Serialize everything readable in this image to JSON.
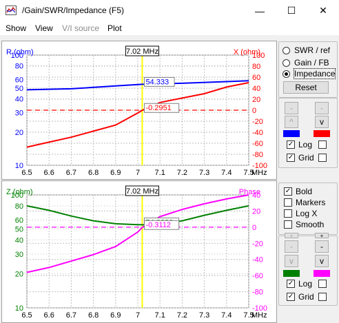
{
  "window": {
    "title": "/Gain/SWR/Impedance (F5)",
    "minimize_glyph": "—",
    "maximize_glyph": "☐",
    "close_glyph": "✕"
  },
  "menu": [
    {
      "label": "Show",
      "enabled": true
    },
    {
      "label": "View",
      "enabled": true
    },
    {
      "label": "V/I source",
      "enabled": false
    },
    {
      "label": "Plot",
      "enabled": true
    }
  ],
  "colors": {
    "blue": "#0000ff",
    "red": "#ff0000",
    "green": "#008000",
    "magenta": "#ff00ff",
    "marker": "#ffff00",
    "grid": "#bdbdbd"
  },
  "chart_data": [
    {
      "type": "line",
      "marker_label": "7.02 MHz",
      "marker_x": 7.02,
      "xlabel": "MHz",
      "xlim": [
        6.5,
        7.5
      ],
      "x_ticks": [
        6.5,
        6.6,
        6.7,
        6.8,
        6.9,
        7,
        7.1,
        7.2,
        7.3,
        7.4,
        7.5
      ],
      "left_axis": {
        "label": "R (ohm)",
        "scale": "log",
        "range": [
          10,
          100
        ],
        "ticks": [
          10,
          20,
          30,
          40,
          50,
          60,
          80,
          100
        ],
        "color": "blue"
      },
      "right_axis": {
        "label": "X (ohm)",
        "scale": "linear",
        "range": [
          -100,
          100
        ],
        "ticks": [
          -100,
          -80,
          -60,
          -40,
          -20,
          0,
          20,
          40,
          60,
          80,
          100
        ],
        "color": "red"
      },
      "series": [
        {
          "axis": "left",
          "color": "blue",
          "x": [
            6.5,
            6.7,
            6.9,
            7.02,
            7.2,
            7.4,
            7.5
          ],
          "y": [
            48.4,
            49.5,
            52.5,
            54.333,
            55.5,
            57.5,
            58.5
          ]
        },
        {
          "axis": "right",
          "color": "red",
          "x": [
            6.5,
            6.6,
            6.7,
            6.8,
            6.9,
            7,
            7.02,
            7.1,
            7.2,
            7.3,
            7.4,
            7.5
          ],
          "y": [
            -67,
            -58,
            -49,
            -38,
            -27,
            -5,
            -0.2951,
            14,
            22,
            30,
            42,
            50
          ]
        }
      ],
      "reference_line": {
        "axis": "right",
        "y": 0,
        "color": "red",
        "style": "dashed"
      },
      "readouts": [
        {
          "text": "54.333",
          "x": 7.02,
          "axis": "left",
          "y": 54.333
        },
        {
          "text": "-0.2951",
          "x": 7.02,
          "axis": "right",
          "y": -0.2951
        }
      ]
    },
    {
      "type": "line",
      "marker_label": "7.02 MHz",
      "marker_x": 7.02,
      "xlabel": "MHz",
      "xlim": [
        6.5,
        7.5
      ],
      "x_ticks": [
        6.5,
        6.6,
        6.7,
        6.8,
        6.9,
        7,
        7.1,
        7.2,
        7.3,
        7.4,
        7.5
      ],
      "left_axis": {
        "label": "Z (ohm)",
        "scale": "log",
        "range": [
          10,
          100
        ],
        "ticks": [
          10,
          20,
          30,
          40,
          50,
          60,
          80,
          100
        ],
        "color": "green"
      },
      "right_axis": {
        "label": "Phase",
        "scale": "linear",
        "range": [
          -100,
          40
        ],
        "ticks": [
          -100,
          -80,
          -60,
          -40,
          -20,
          0,
          20,
          40
        ],
        "color": "magenta"
      },
      "series": [
        {
          "axis": "left",
          "color": "green",
          "x": [
            6.5,
            6.6,
            6.7,
            6.8,
            6.9,
            7,
            7.02,
            7.1,
            7.2,
            7.3,
            7.4,
            7.5
          ],
          "y": [
            80,
            73,
            65,
            59,
            55.5,
            54.5,
            54.3338,
            55,
            59,
            66,
            73,
            80
          ]
        },
        {
          "axis": "right",
          "color": "magenta",
          "x": [
            6.5,
            6.6,
            6.7,
            6.8,
            6.9,
            7,
            7.02,
            7.1,
            7.2,
            7.3,
            7.4,
            7.5
          ],
          "y": [
            -56,
            -50,
            -42,
            -34,
            -24,
            -6,
            -0.3112,
            13,
            22,
            29,
            35,
            40
          ]
        }
      ],
      "reference_line": {
        "axis": "right",
        "y": 0,
        "color": "magenta",
        "style": "dashed"
      },
      "readouts": [
        {
          "text": "54.3338",
          "x": 7.02,
          "axis": "left",
          "y": 54.3338
        },
        {
          "text": "-0.3112",
          "x": 7.02,
          "axis": "right",
          "y": -0.3112
        }
      ]
    }
  ],
  "right_panel": {
    "radios": [
      {
        "label": "SWR / ref",
        "checked": false
      },
      {
        "label": "Gain / FB",
        "checked": false
      },
      {
        "label": "Impedance",
        "checked": true
      }
    ],
    "reset_label": "Reset",
    "top_group": {
      "buttons": [
        {
          "label": "-",
          "enabled": false
        },
        {
          "label": "-",
          "enabled": false
        },
        {
          "label": "^",
          "enabled": true
        },
        {
          "label": "v",
          "enabled": true
        }
      ],
      "swatch_colors": [
        "blue",
        "red"
      ],
      "checks": [
        {
          "label": "Log",
          "checked": true,
          "extra_checked": false
        },
        {
          "label": "Grid",
          "checked": true,
          "extra_checked": false
        }
      ]
    },
    "options": [
      {
        "label": "Bold",
        "checked": true
      },
      {
        "label": "Markers",
        "checked": false
      },
      {
        "label": "Log X",
        "checked": false
      },
      {
        "label": "Smooth",
        "checked": false
      }
    ],
    "bottom_group": {
      "buttons": [
        {
          "label": "+",
          "enabled": false
        },
        {
          "label": "+",
          "enabled": true
        },
        {
          "label": "-",
          "enabled": false
        },
        {
          "label": "-",
          "enabled": true
        },
        {
          "label": "v",
          "enabled": false
        },
        {
          "label": "v",
          "enabled": true
        }
      ],
      "swatch_colors": [
        "green",
        "magenta"
      ],
      "checks": [
        {
          "label": "Log",
          "checked": true,
          "extra_checked": false
        },
        {
          "label": "Grid",
          "checked": true,
          "extra_checked": false
        }
      ]
    }
  }
}
